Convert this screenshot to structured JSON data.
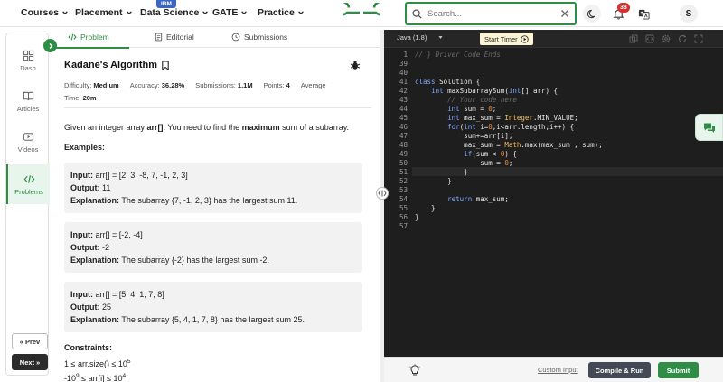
{
  "nav": {
    "items": [
      "Courses",
      "Placement",
      "Data Science",
      "GATE",
      "Practice"
    ],
    "ibm_badge": "IBM",
    "search_placeholder": "Search...",
    "notification_count": "38",
    "avatar_initial": "S"
  },
  "sidebar": {
    "items": [
      {
        "label": "Dash",
        "icon": "dashboard-icon"
      },
      {
        "label": "Articles",
        "icon": "book-icon"
      },
      {
        "label": "Videos",
        "icon": "video-icon"
      },
      {
        "label": "Problems",
        "icon": "code-icon",
        "active": true
      }
    ],
    "prev_label": "Prev",
    "next_label": "Next"
  },
  "tabs": [
    {
      "label": "Problem",
      "icon": "code-icon",
      "active": true
    },
    {
      "label": "Editorial",
      "icon": "document-icon"
    },
    {
      "label": "Submissions",
      "icon": "clock-icon"
    }
  ],
  "problem": {
    "title": "Kadane's Algorithm",
    "difficulty_label": "Difficulty:",
    "difficulty": "Medium",
    "accuracy_label": "Accuracy:",
    "accuracy": "36.28%",
    "submissions_label": "Submissions:",
    "submissions": "1.1M",
    "points_label": "Points:",
    "points": "4",
    "avg_label": "Average",
    "time_label": "Time:",
    "time": "20m",
    "desc_pre": "Given an integer array ",
    "desc_arr": "arr[]",
    "desc_mid": ". You need to find the ",
    "desc_max": "maximum",
    "desc_post": " sum of a subarray.",
    "examples_heading": "Examples:",
    "examples": [
      {
        "input": "arr[] = [2, 3, -8, 7, -1, 2, 3]",
        "output": "11",
        "explanation": "The subarray {7, -1, 2, 3} has the largest sum 11."
      },
      {
        "input": "arr[] = [-2, -4]",
        "output": "-2",
        "explanation": "The subarray {-2} has the largest sum -2."
      },
      {
        "input": "arr[] = [5, 4, 1, 7, 8]",
        "output": "25",
        "explanation": "The subarray {5, 4, 1, 7, 8} has the largest sum 25."
      }
    ],
    "input_label": "Input:",
    "output_label": "Output:",
    "explanation_label": "Explanation:",
    "constraints_heading": "Constraints:",
    "constraint1_pre": "1 ≤ arr.size() ≤ 10",
    "constraint1_exp": "5",
    "constraint2_pre": "-10",
    "constraint2_exp": "9",
    "constraint2_mid": " ≤ arr[i] ≤ 10",
    "constraint2_exp2": "4"
  },
  "editor": {
    "language": "Java (1.8)",
    "timer_label": "Start Timer",
    "lines": [
      {
        "n": "1",
        "code": "// } Driver Code Ends",
        "cls": "cm"
      },
      {
        "n": "39",
        "code": ""
      },
      {
        "n": "40",
        "code": ""
      },
      {
        "n": "41",
        "code": "class Solution {"
      },
      {
        "n": "42",
        "code": "    int maxSubarraySum(int[] arr) {"
      },
      {
        "n": "43",
        "code": "        // Your code here",
        "cls": "cm"
      },
      {
        "n": "44",
        "code": "        int sum = 0;"
      },
      {
        "n": "45",
        "code": "        int max_sum = Integer.MIN_VALUE;"
      },
      {
        "n": "46",
        "code": "        for(int i=0;i<arr.length;i++) {"
      },
      {
        "n": "47",
        "code": "            sum+=arr[i];"
      },
      {
        "n": "48",
        "code": "            max_sum = Math.max(max_sum , sum);"
      },
      {
        "n": "49",
        "code": "            if(sum < 0) {"
      },
      {
        "n": "50",
        "code": "                sum = 0;"
      },
      {
        "n": "51",
        "code": "            }"
      },
      {
        "n": "52",
        "code": "        }"
      },
      {
        "n": "53",
        "code": ""
      },
      {
        "n": "54",
        "code": "        return max_sum;"
      },
      {
        "n": "55",
        "code": "    }"
      },
      {
        "n": "56",
        "code": "}"
      },
      {
        "n": "57",
        "code": ""
      }
    ],
    "custom_input": "Custom Input",
    "compile_label": "Compile & Run",
    "submit_label": "Submit"
  },
  "colors": {
    "brand": "#2f8d46",
    "editor_bg": "#1e1e1e"
  }
}
